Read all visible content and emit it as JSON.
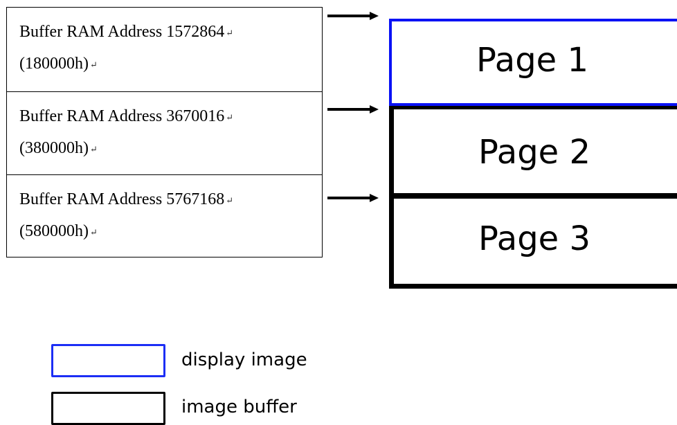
{
  "addresses": [
    {
      "line1": "Buffer RAM Address 1572864",
      "line2": "(180000h)",
      "return_mark": "↵"
    },
    {
      "line1": "Buffer RAM Address 3670016",
      "line2": "(380000h)",
      "return_mark": "↵"
    },
    {
      "line1": "Buffer RAM Address 5767168",
      "line2": "(580000h)",
      "return_mark": "↵"
    }
  ],
  "pages": [
    {
      "label": "Page 1"
    },
    {
      "label": "Page 2"
    },
    {
      "label": "Page 3"
    }
  ],
  "legend": {
    "display_image": "display image",
    "image_buffer": "image buffer"
  },
  "colors": {
    "display_border": "#0a12f5",
    "buffer_border": "#000000"
  },
  "icons": {
    "arrow": "right-arrow-icon"
  }
}
